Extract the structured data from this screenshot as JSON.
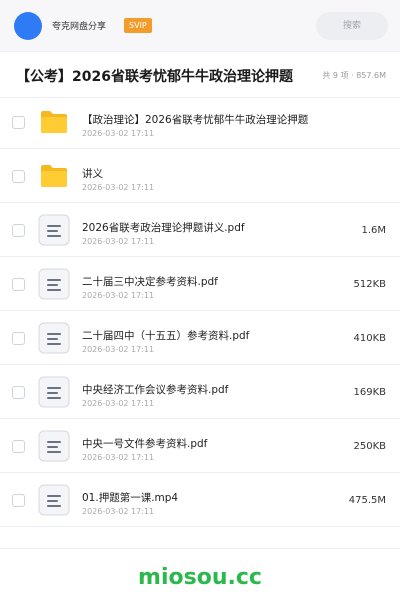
{
  "header": {
    "sharer_name": "夸克网盘分享",
    "badge": "SVIP",
    "search_placeholder": "搜索",
    "avatar_color": "#2f7bf5"
  },
  "folder": {
    "title": "【公考】2026省联考忧郁牛牛政治理论押题",
    "count_info": "共 9 项 · 857.6M"
  },
  "files": [
    {
      "type": "folder",
      "name": "【政治理论】2026省联考忧郁牛牛政治理论押题",
      "date": "2026-03-02 17:11",
      "size": ""
    },
    {
      "type": "folder",
      "name": "讲义",
      "date": "2026-03-02 17:11",
      "size": ""
    },
    {
      "type": "file",
      "name": "2026省联考政治理论押题讲义.pdf",
      "date": "2026-03-02 17:11",
      "size": "1.6M"
    },
    {
      "type": "file",
      "name": "二十届三中决定参考资料.pdf",
      "date": "2026-03-02 17:11",
      "size": "512KB"
    },
    {
      "type": "file",
      "name": "二十届四中（十五五）参考资料.pdf",
      "date": "2026-03-02 17:11",
      "size": "410KB"
    },
    {
      "type": "file",
      "name": "中央经济工作会议参考资料.pdf",
      "date": "2026-03-02 17:11",
      "size": "169KB"
    },
    {
      "type": "file",
      "name": "中央一号文件参考资料.pdf",
      "date": "2026-03-02 17:11",
      "size": "250KB"
    },
    {
      "type": "file",
      "name": "01.押题第一课.mp4",
      "date": "2026-03-02 17:11",
      "size": "475.5M"
    }
  ],
  "footer": {
    "brand": "miosou.cc",
    "brand_color": "#2db84d"
  }
}
